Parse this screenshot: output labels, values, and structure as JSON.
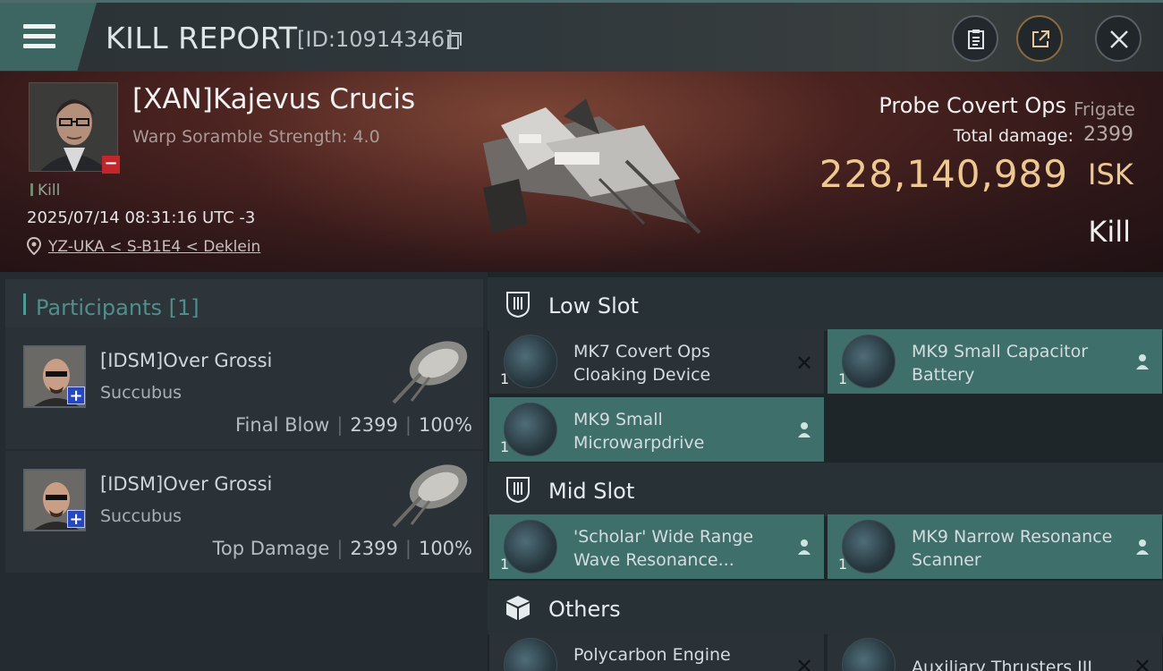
{
  "header": {
    "title": "KILL REPORT",
    "report_id": "[ID:10914346]"
  },
  "victim": {
    "name": "[XAN]Kajevus Crucis",
    "warp_text": "Warp Soramble Strength: 4.0",
    "kill_label": "Kill",
    "datetime": "2025/07/14 08:31:16 UTC -3",
    "location": "YZ-UKA < S-B1E4 < Deklein",
    "ship_name": "Probe Covert Ops",
    "ship_class": "Frigate",
    "damage_label": "Total damage:",
    "damage_value": "2399",
    "isk_value": "228,140,989",
    "isk_unit": "ISK",
    "result": "Kill"
  },
  "participants": {
    "title": "Participants [1]",
    "list": [
      {
        "name": "[IDSM]Over Grossi",
        "ship": "Succubus",
        "label": "Final Blow",
        "damage": "2399",
        "percent": "100%"
      },
      {
        "name": "[IDSM]Over Grossi",
        "ship": "Succubus",
        "label": "Top Damage",
        "damage": "2399",
        "percent": "100%"
      }
    ]
  },
  "slots": {
    "low": {
      "label": "Low Slot",
      "items": [
        {
          "name": "MK7 Covert Ops Cloaking Device",
          "qty": "1",
          "state": "destroyed"
        },
        {
          "name": "MK9 Small Capacitor Battery",
          "qty": "1",
          "state": "dropped"
        },
        {
          "name": "MK9 Small Microwarpdrive",
          "qty": "1",
          "state": "dropped"
        }
      ]
    },
    "mid": {
      "label": "Mid Slot",
      "items": [
        {
          "name": "'Scholar' Wide Range Wave Resonance...",
          "qty": "1",
          "state": "dropped"
        },
        {
          "name": "MK9 Narrow Resonance Scanner",
          "qty": "1",
          "state": "dropped"
        }
      ]
    },
    "others": {
      "label": "Others",
      "items": [
        {
          "name": "Polycarbon Engine",
          "qty": "",
          "state": "destroyed"
        },
        {
          "name": "Auxiliary Thrusters III",
          "qty": "",
          "state": "destroyed"
        }
      ]
    }
  },
  "colors": {
    "accent_teal": "#3f6f6b",
    "isk_gold": "#eec98e",
    "kill_red": "#c3262a",
    "ally_blue": "#2446c9"
  }
}
